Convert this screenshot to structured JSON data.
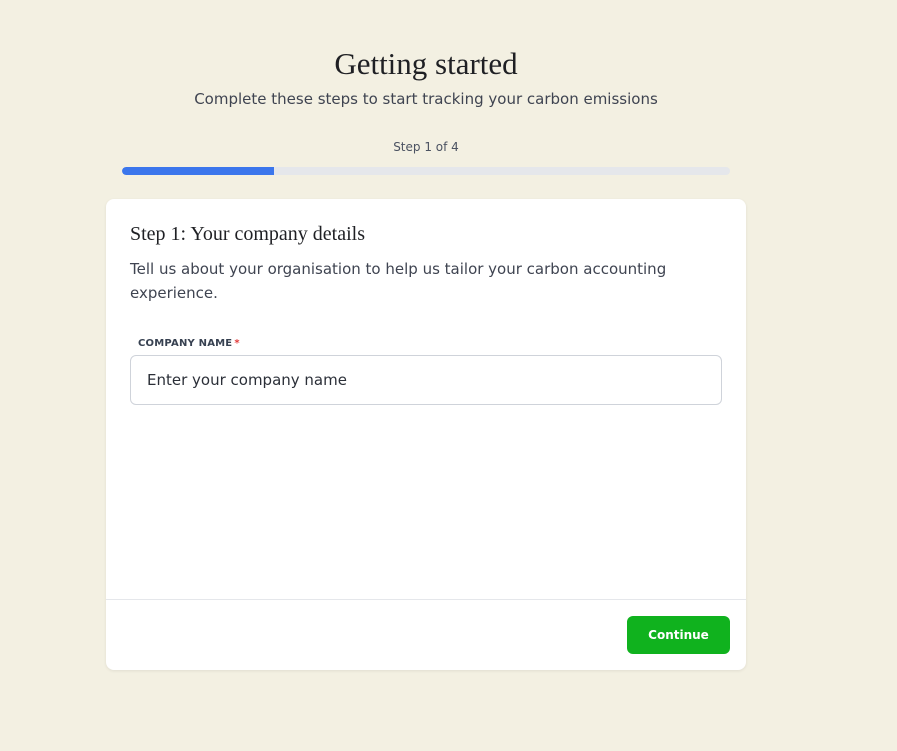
{
  "header": {
    "title": "Getting started",
    "subtitle": "Complete these steps to start tracking your carbon emissions"
  },
  "progress": {
    "label": "Step 1 of 4",
    "current_step": 1,
    "total_steps": 4,
    "fraction": 0.25,
    "fill_color": "#3b76ec",
    "track_color": "#e5e7eb"
  },
  "card": {
    "title": "Step 1: Your company details",
    "description": "Tell us about your organisation to help us tailor your carbon accounting experience.",
    "company_field": {
      "label": "COMPANY NAME",
      "required_marker": "*",
      "value": "",
      "placeholder": "Enter your company name"
    },
    "continue_label": "Continue",
    "continue_color": "#10b21e"
  },
  "colors": {
    "page_background": "#f3f0e2",
    "card_background": "#ffffff",
    "required_color": "#e23a3a"
  }
}
